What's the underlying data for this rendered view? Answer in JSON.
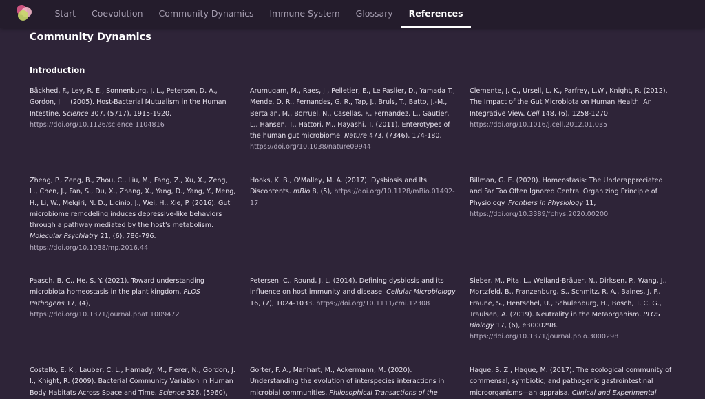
{
  "nav": {
    "items": [
      {
        "label": "Start",
        "active": false
      },
      {
        "label": "Coevolution",
        "active": false
      },
      {
        "label": "Community Dynamics",
        "active": false
      },
      {
        "label": "Immune System",
        "active": false
      },
      {
        "label": "Glossary",
        "active": false
      },
      {
        "label": "References",
        "active": true
      }
    ]
  },
  "colors": {
    "background": "#2e2438",
    "topbar": "#241c2c",
    "logo": [
      "#e05a8a",
      "#f4b6c8",
      "#c8d86a"
    ]
  },
  "page_title": "Community Dynamics",
  "section_title": "Introduction",
  "references": [
    {
      "authors": "Bäckhed, F., Ley, R. E., Sonnenburg, J. L., Peterson, D. A., Gordon, J. I. (2005). Host-Bacterial Mutualism in the Human Intestine.",
      "journal": "Science",
      "details": "307, (5717), 1915-1920.",
      "doi": "https://doi.org/10.1126/science.1104816"
    },
    {
      "authors": "Arumugam, M., Raes, J., Pelletier, E., Le Paslier, D., Yamada T., Mende, D. R., Fernandes, G. R., Tap, J., Bruls, T., Batto, J.-M., Bertalan, M., Borruel, N., Casellas, F., Fernandez, L., Gautier, L., Hansen, T., Hattori, M., Hayashi, T. (2011). Enterotypes of the human gut microbiome.",
      "journal": "Nature",
      "details": "473, (7346), 174-180.",
      "doi": "https://doi.org/10.1038/nature09944"
    },
    {
      "authors": "Clemente, J. C., Ursell, L. K., Parfrey, L.W., Knight, R. (2012). The Impact of the Gut Microbiota on Human Health: An Integrative View.",
      "journal": "Cell",
      "details": "148, (6), 1258-1270.",
      "doi": "https://doi.org/10.1016/j.cell.2012.01.035"
    },
    {
      "authors": "Zheng, P., Zeng, B., Zhou, C., Liu, M., Fang, Z., Xu, X., Zeng, L., Chen, J., Fan, S., Du, X., Zhang, X., Yang, D., Yang, Y., Meng, H., Li, W., Melgiri, N. D., Licinio, J., Wei, H., Xie, P. (2016). Gut microbiome remodeling induces depressive-like behaviors through a pathway mediated by the host's metabolism.",
      "journal": "Molecular Psychiatry",
      "details": "21, (6), 786-796.",
      "doi": "https://doi.org/10.1038/mp.2016.44"
    },
    {
      "authors": "Hooks, K. B., O'Malley, M. A. (2017). Dysbiosis and Its Discontents.",
      "journal": "mBio",
      "details": "8, (5),",
      "doi": "https://doi.org/10.1128/mBio.01492-17"
    },
    {
      "authors": "Billman, G. E. (2020). Homeostasis: The Underappreciated and Far Too Often Ignored Central Organizing Principle of Physiology.",
      "journal": "Frontiers in Physiology",
      "details": "11,",
      "doi": "https://doi.org/10.3389/fphys.2020.00200"
    },
    {
      "authors": "Paasch, B. C., He, S. Y. (2021). Toward understanding microbiota homeostasis in the plant kingdom.",
      "journal": "PLOS Pathogens",
      "details": "17, (4),",
      "doi": "https://doi.org/10.1371/journal.ppat.1009472"
    },
    {
      "authors": "Petersen, C., Round, J. L. (2014). Defining dysbiosis and its influence on host immunity and disease.",
      "journal": "Cellular Microbiology",
      "details": "16, (7), 1024-1033.",
      "doi": "https://doi.org/10.1111/cmi.12308"
    },
    {
      "authors": "Sieber, M., Pita, L., Weiland-Bräuer, N., Dirksen, P., Wang, J., Mortzfeld, B., Franzenburg, S., Schmitz, R. A., Baines, J. F., Fraune, S., Hentschel, U., Schulenburg, H., Bosch, T. C. G., Traulsen, A. (2019). Neutrality in the Metaorganism.",
      "journal": "PLOS Biology",
      "details": "17, (6), e3000298.",
      "doi": "https://doi.org/10.1371/journal.pbio.3000298"
    },
    {
      "authors": "Costello, E. K., Lauber, C. L., Hamady, M., Fierer, N., Gordon, J. I., Knight, R. (2009). Bacterial Community Variation in Human Body Habitats Across Space and Time.",
      "journal": "Science",
      "details": "326, (5960),",
      "doi": ""
    },
    {
      "authors": "Gorter, F. A., Manhart, M., Ackermann, M. (2020). Understanding the evolution of interspecies interactions in microbial communities.",
      "journal": "Philosophical Transactions of the",
      "details": "",
      "doi": ""
    },
    {
      "authors": "Haque, S. Z., Haque, M. (2017). The ecological community of commensal, symbiotic, and pathogenic gastrointestinal microorganisms—an appraisa.",
      "journal": "Clinical and Experimental",
      "details": "",
      "doi": ""
    }
  ]
}
